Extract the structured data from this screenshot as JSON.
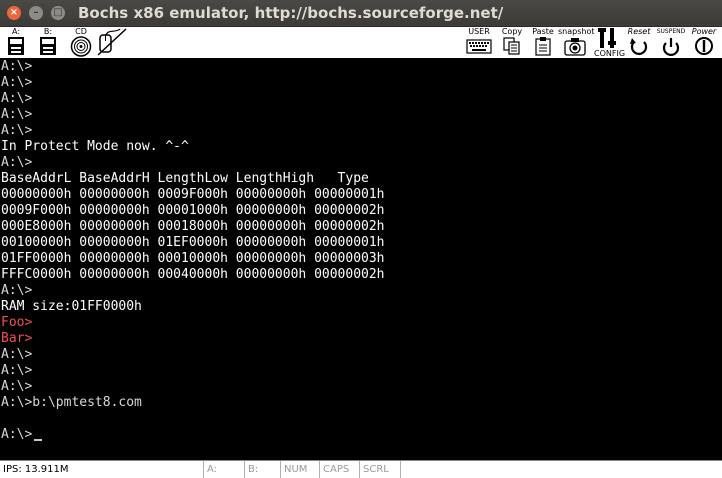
{
  "window": {
    "title": "Bochs x86 emulator, http://bochs.sourceforge.net/",
    "close_glyph": "×",
    "minimize_glyph": "–",
    "maximize_glyph": "□"
  },
  "toolbar": {
    "floppy_a_label": "A:",
    "floppy_b_label": "B:",
    "cdrom_label": "CD",
    "user_label": "USER",
    "copy_label": "Copy",
    "paste_label": "Paste",
    "snapshot_label": "snapshot",
    "config_label": "CONFIG",
    "reset_label": "Reset",
    "suspend_label": "SUSPEND",
    "power_label": "Power"
  },
  "console": {
    "lines": [
      "A:\\>",
      "A:\\>",
      "A:\\>",
      "A:\\>",
      "A:\\>",
      "In Protect Mode now. ^-^",
      "A:\\>",
      "BaseAddrL BaseAddrH LengthLow LengthHigh   Type",
      "00000000h 00000000h 0009F000h 00000000h 00000001h",
      "0009F000h 00000000h 00001000h 00000000h 00000002h",
      "000E8000h 00000000h 00018000h 00000000h 00000002h",
      "00100000h 00000000h 01EF0000h 00000000h 00000001h",
      "01FF0000h 00000000h 00010000h 00000000h 00000003h",
      "FFFC0000h 00000000h 00040000h 00000000h 00000002h",
      "A:\\>",
      "RAM size:01FF0000h",
      "Foo>",
      "Bar>",
      "A:\\>",
      "A:\\>",
      "A:\\>",
      "A:\\>b:\\pmtest8.com",
      "",
      "A:\\>"
    ]
  },
  "status": {
    "ips": "IPS: 13.911M",
    "a": "A:",
    "b": "B:",
    "num": "NUM",
    "caps": "CAPS",
    "scrl": "SCRL"
  }
}
